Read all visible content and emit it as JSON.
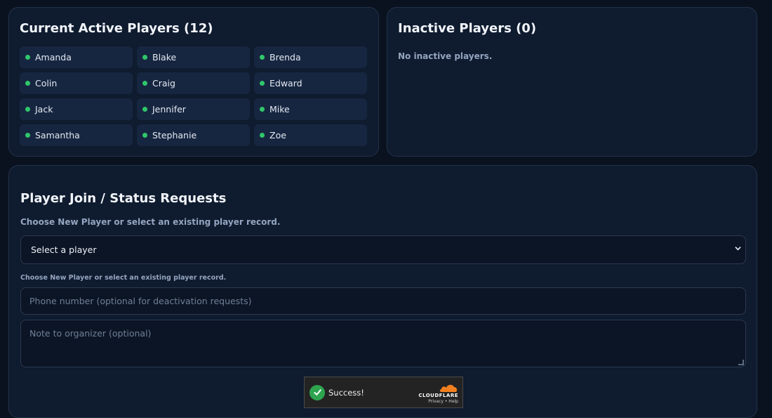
{
  "active": {
    "title": "Current Active Players (12)",
    "players": [
      "Amanda",
      "Blake",
      "Brenda",
      "Colin",
      "Craig",
      "Edward",
      "Jack",
      "Jennifer",
      "Mike",
      "Samantha",
      "Stephanie",
      "Zoe"
    ],
    "status_color": "#2fc76a"
  },
  "inactive": {
    "title": "Inactive Players (0)",
    "empty_message": "No inactive players."
  },
  "request": {
    "title": "Player Join / Status Requests",
    "hint": "Choose New Player or select an existing player record.",
    "select_value": "Select a player",
    "small_hint": "Choose New Player or select an existing player record.",
    "phone_placeholder": "Phone number (optional for deactivation requests)",
    "note_placeholder": "Note to organizer (optional)"
  },
  "captcha": {
    "status": "Success!",
    "brand": "CLOUDFLARE",
    "links": "Privacy • Help",
    "icon": "check-circle-icon"
  }
}
